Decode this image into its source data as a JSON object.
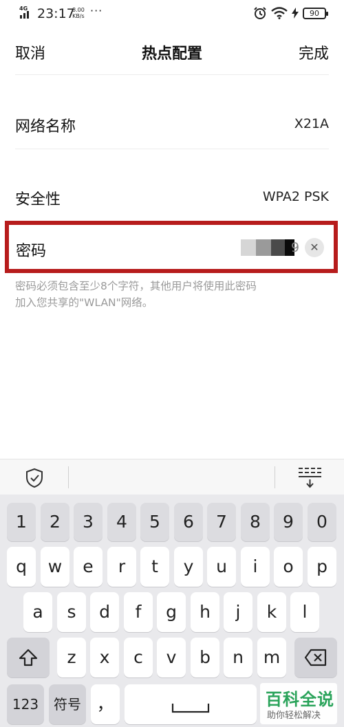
{
  "status_bar": {
    "network": "4G",
    "time": "23:17",
    "speed_value": "8.00",
    "speed_unit": "KB/s",
    "dots": "···",
    "battery": "90"
  },
  "nav": {
    "cancel_label": "取消",
    "title": "热点配置",
    "done_label": "完成"
  },
  "settings": {
    "network_name_label": "网络名称",
    "network_name_value": "X21A",
    "security_label": "安全性",
    "security_value": "WPA2 PSK",
    "password_label": "密码",
    "password_visible_tail": "9"
  },
  "hint": {
    "line1": "密码必须包含至少8个字符，其他用户将使用此密码",
    "line2": "加入您共享的\"WLAN\"网络。"
  },
  "keyboard": {
    "row_numbers": [
      "1",
      "2",
      "3",
      "4",
      "5",
      "6",
      "7",
      "8",
      "9",
      "0"
    ],
    "row_1": [
      "q",
      "w",
      "e",
      "r",
      "t",
      "y",
      "u",
      "i",
      "o",
      "p"
    ],
    "row_2": [
      "a",
      "s",
      "d",
      "f",
      "g",
      "h",
      "j",
      "k",
      "l"
    ],
    "row_3": [
      "z",
      "x",
      "c",
      "v",
      "b",
      "n",
      "m"
    ],
    "mode_123": "123",
    "mode_symbols": "符号",
    "comma": "，"
  },
  "watermark": {
    "title": "百科全说",
    "subtitle": "助你轻松解决"
  },
  "colors": {
    "highlight_border": "#b71c1c",
    "watermark_green": "#2aa35a"
  }
}
